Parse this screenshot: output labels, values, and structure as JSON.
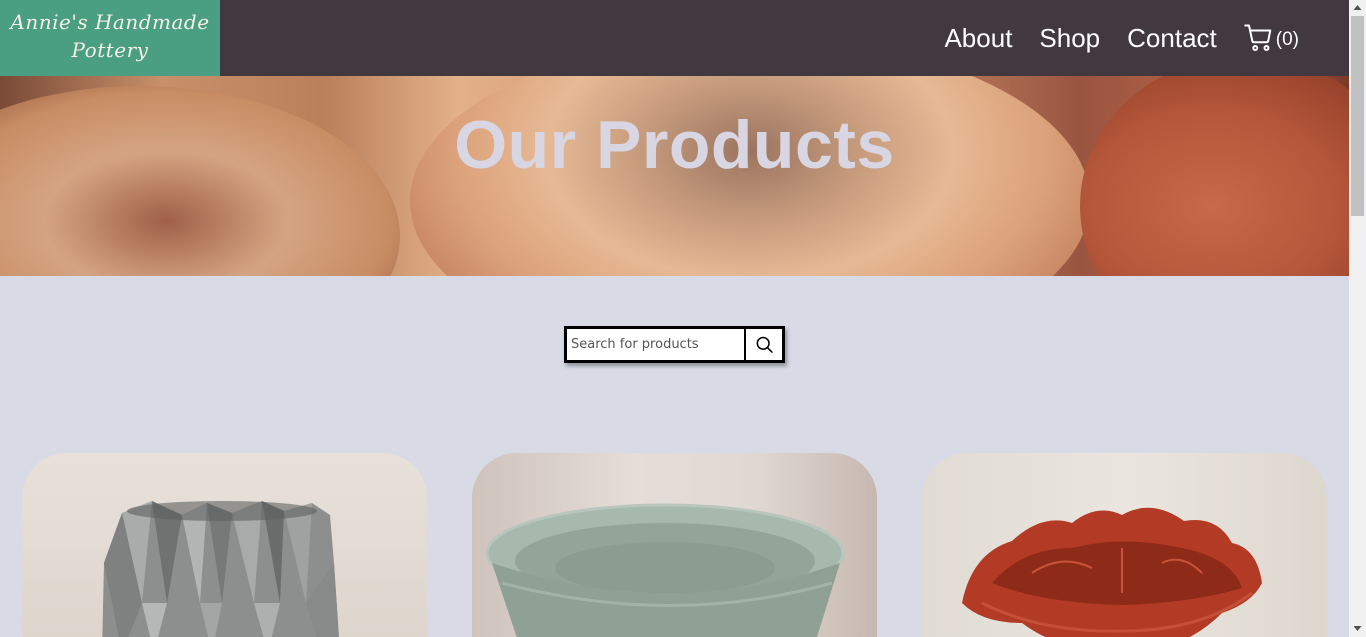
{
  "header": {
    "logo_line1": "Annie's Handmade",
    "logo_line2": "Pottery",
    "nav": {
      "about": "About",
      "shop": "Shop",
      "contact": "Contact"
    },
    "cart_count": "(0)"
  },
  "hero": {
    "title": "Our Products"
  },
  "search": {
    "placeholder": "Search for products",
    "value": ""
  },
  "products": [
    {
      "image": "gray-faceted-vase"
    },
    {
      "image": "celadon-green-bowl"
    },
    {
      "image": "red-leaf-bowl"
    }
  ],
  "colors": {
    "header_bg": "#41393f",
    "logo_bg": "#4a9e82",
    "page_bg": "#d8dae6",
    "hero_title": "#d7d6e2"
  }
}
